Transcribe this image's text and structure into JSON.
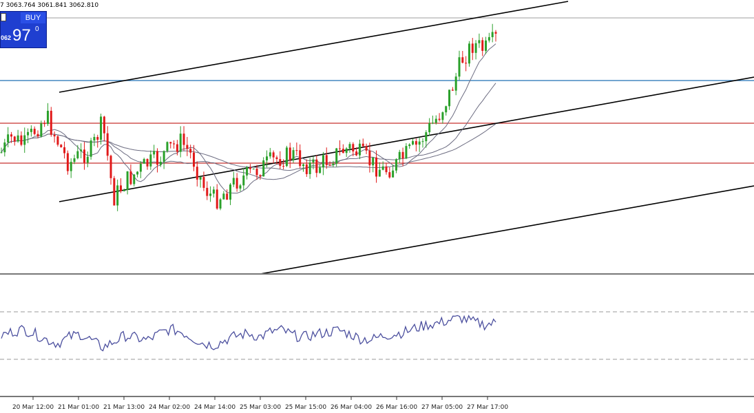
{
  "header": {
    "ohlc_text": "7 3063.764 3061.841 3062.810"
  },
  "trade_panel": {
    "buy_label": "BUY",
    "price_small": "062",
    "price_big": "97",
    "price_superscript": "0"
  },
  "colors": {
    "candle_bull": "#2aa02a",
    "candle_bear": "#e11a1a",
    "channel": "#000000",
    "resistance_blue": "#1f6fb3",
    "support_red": "#c8322f",
    "moving_average": "#6b6b80",
    "oscillator": "#4b4f9e",
    "panel_blue": "#1f3fd0"
  },
  "chart_data": {
    "type": "candlestick",
    "x_ticks": [
      "20 Mar 12:00",
      "21 Mar 01:00",
      "21 Mar 13:00",
      "24 Mar 02:00",
      "24 Mar 14:00",
      "25 Mar 03:00",
      "25 Mar 15:00",
      "26 Mar 04:00",
      "26 Mar 16:00",
      "27 Mar 05:00",
      "27 Mar 17:00"
    ],
    "price_close_profile": [
      0.45,
      0.52,
      0.48,
      0.55,
      0.61,
      0.5,
      0.4,
      0.44,
      0.46,
      0.58,
      0.25,
      0.32,
      0.36,
      0.4,
      0.42,
      0.47,
      0.5,
      0.43,
      0.3,
      0.24,
      0.28,
      0.33,
      0.35,
      0.38,
      0.41,
      0.43,
      0.44,
      0.4,
      0.38,
      0.42,
      0.45,
      0.47,
      0.44,
      0.4,
      0.37,
      0.39,
      0.44,
      0.48,
      0.55,
      0.62,
      0.72,
      0.86,
      0.93,
      0.9,
      0.95
    ],
    "oscillator_profile": [
      50,
      55,
      58,
      52,
      45,
      40,
      48,
      52,
      44,
      35,
      42,
      50,
      47,
      44,
      52,
      58,
      55,
      47,
      40,
      38,
      45,
      50,
      53,
      48,
      55,
      57,
      50,
      48,
      52,
      54,
      57,
      52,
      46,
      45,
      50,
      52,
      55,
      60,
      64,
      66,
      70,
      72,
      67,
      64,
      66
    ],
    "grid": false,
    "legend": "none"
  }
}
